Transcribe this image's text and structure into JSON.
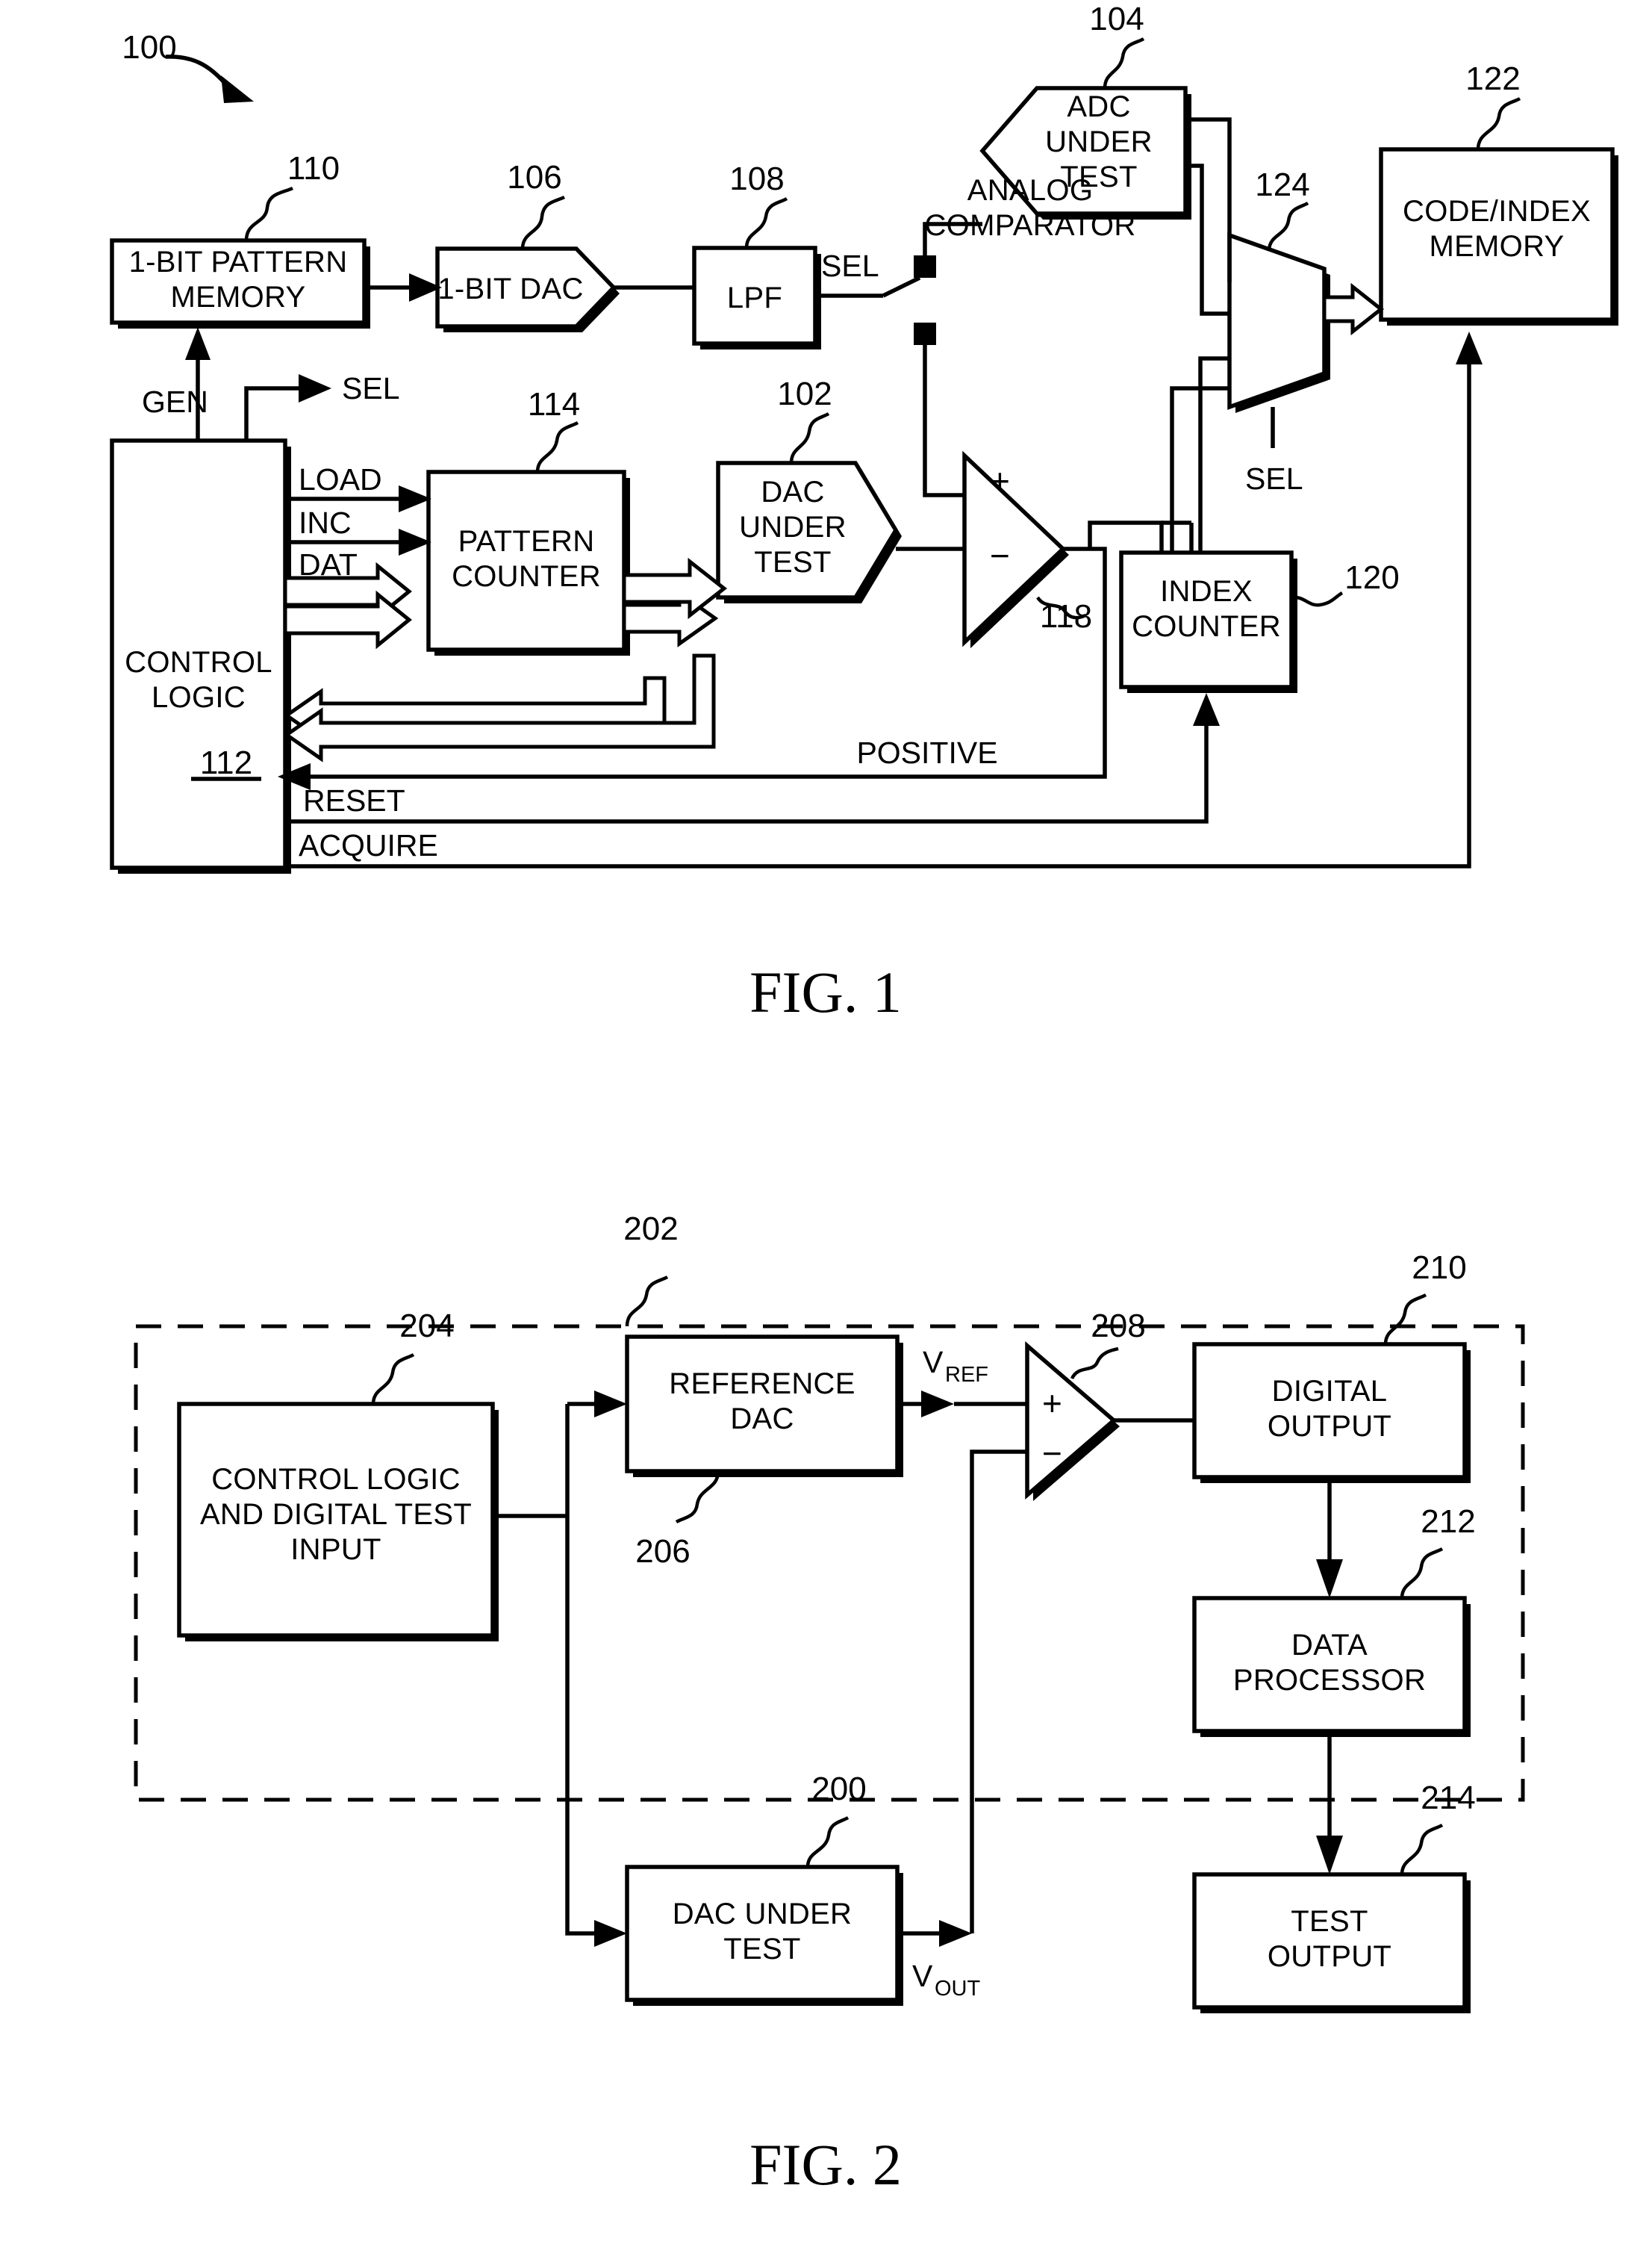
{
  "figure1": {
    "caption": "FIG. 1",
    "ref_numbers": {
      "system": "100",
      "dac_under_test": "102",
      "adc_under_test": "104",
      "one_bit_dac": "106",
      "lpf": "108",
      "pattern_memory": "110",
      "control_logic": "112",
      "pattern_counter": "114",
      "comparator": "118",
      "index_counter": "120",
      "code_index_memory": "122",
      "mux": "124"
    },
    "blocks": {
      "pattern_memory": [
        "1-BIT PATTERN",
        "MEMORY"
      ],
      "one_bit_dac": [
        "1-BIT DAC"
      ],
      "lpf": [
        "LPF"
      ],
      "adc_under_test": [
        "ADC",
        "UNDER",
        "TEST"
      ],
      "code_index_memory": [
        "CODE/INDEX",
        "MEMORY"
      ],
      "control_logic": [
        "CONTROL",
        "LOGIC"
      ],
      "pattern_counter": [
        "PATTERN",
        "COUNTER"
      ],
      "dac_under_test": [
        "DAC",
        "UNDER",
        "TEST"
      ],
      "index_counter": [
        "INDEX",
        "COUNTER"
      ],
      "analog_comparator": [
        "ANALOG",
        "COMPARATOR"
      ]
    },
    "signals": {
      "gen": "GEN",
      "sel_out": "SEL",
      "sel_switch": "SEL",
      "sel_mux": "SEL",
      "load": "LOAD",
      "inc": "INC",
      "dat": "DAT",
      "positive": "POSITIVE",
      "reset": "RESET",
      "acquire": "ACQUIRE"
    },
    "comparator_pins": {
      "plus": "+",
      "minus": "−"
    }
  },
  "figure2": {
    "caption": "FIG. 2",
    "ref_numbers": {
      "dac_under_test": "200",
      "boundary": "202",
      "control_logic": "204",
      "reference_dac": "206",
      "comparator": "208",
      "digital_output": "210",
      "data_processor": "212",
      "test_output": "214"
    },
    "blocks": {
      "control_logic": [
        "CONTROL LOGIC",
        "AND DIGITAL TEST",
        "INPUT"
      ],
      "reference_dac": [
        "REFERENCE",
        "DAC"
      ],
      "digital_output": [
        "DIGITAL",
        "OUTPUT"
      ],
      "data_processor": [
        "DATA",
        "PROCESSOR"
      ],
      "test_output": [
        "TEST",
        "OUTPUT"
      ],
      "dac_under_test": [
        "DAC UNDER",
        "TEST"
      ]
    },
    "signals": {
      "vref_main": "V",
      "vref_sub": "REF",
      "vout_main": "V",
      "vout_sub": "OUT"
    },
    "comparator_pins": {
      "plus": "+",
      "minus": "−"
    }
  },
  "colors": {
    "ink": "#000000",
    "paper": "#ffffff"
  }
}
